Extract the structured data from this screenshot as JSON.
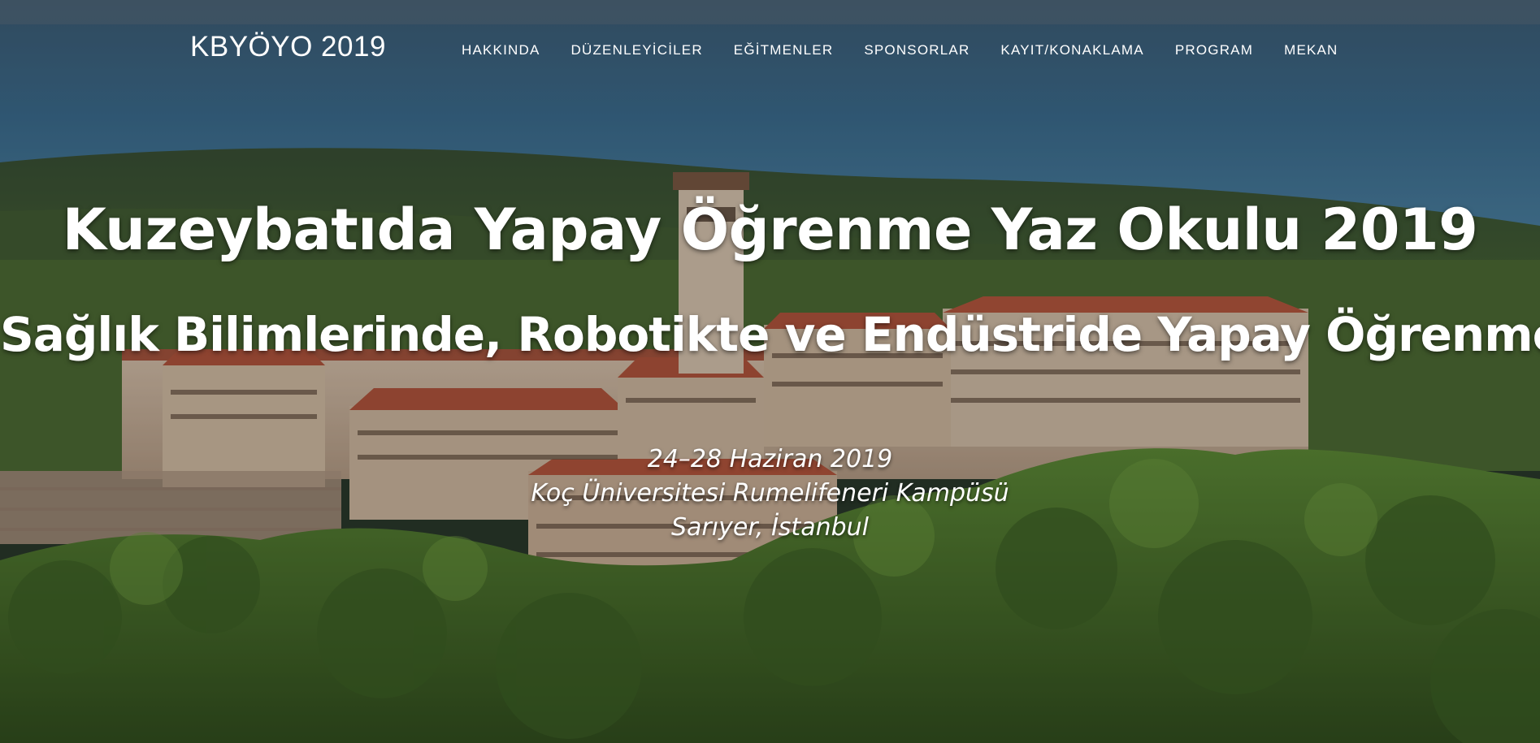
{
  "header": {
    "brand": "KBYÖYO 2019",
    "nav": [
      {
        "label": "HAKKINDA"
      },
      {
        "label": "DÜZENLEYİCİLER"
      },
      {
        "label": "EĞİTMENLER"
      },
      {
        "label": "SPONSORLAR"
      },
      {
        "label": "KAYIT/KONAKLAMA"
      },
      {
        "label": "PROGRAM"
      },
      {
        "label": "MEKAN"
      }
    ]
  },
  "hero": {
    "title": "Kuzeybatıda Yapay Öğrenme Yaz Okulu 2019",
    "subtitle": "Sağlık Bilimlerinde, Robotikte ve Endüstride Yapay Öğrenme",
    "date": "24–28 Haziran 2019",
    "venue": "Koç Üniversitesi Rumelifeneri Kampüsü",
    "location": "Sarıyer, İstanbul"
  }
}
